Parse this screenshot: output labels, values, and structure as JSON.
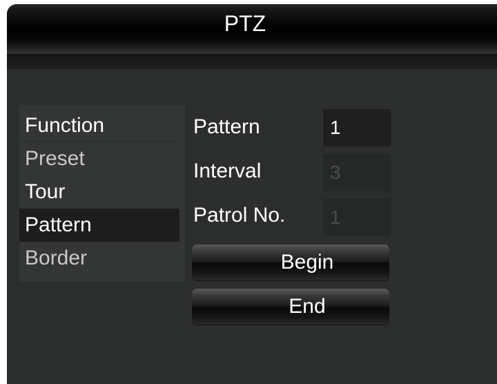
{
  "window": {
    "title": "PTZ"
  },
  "menu": {
    "header": "Function",
    "items": [
      {
        "label": "Preset"
      },
      {
        "label": "Tour"
      },
      {
        "label": "Pattern"
      },
      {
        "label": "Border"
      }
    ],
    "selected": "Pattern"
  },
  "form": {
    "pattern": {
      "label": "Pattern",
      "value": "1"
    },
    "interval": {
      "label": "Interval",
      "value": "3"
    },
    "patrol_no": {
      "label": "Patrol No.",
      "value": "1"
    }
  },
  "buttons": {
    "begin": "Begin",
    "end": "End"
  }
}
